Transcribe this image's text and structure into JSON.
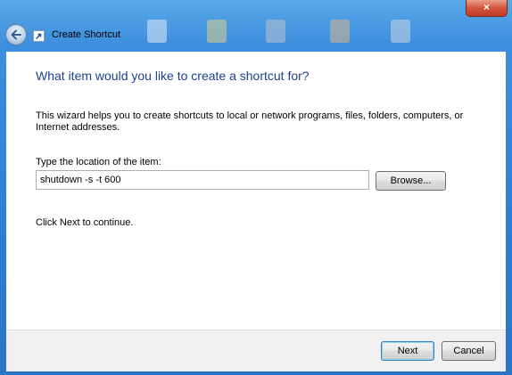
{
  "window": {
    "title": "Create Shortcut",
    "close_symbol": "×",
    "back_icon": "back-arrow-icon",
    "app_icon": "shortcut-icon"
  },
  "wizard": {
    "heading": "What item would you like to create a shortcut for?",
    "description": "This wizard helps you to create shortcuts to local or network programs, files, folders, computers, or Internet addresses.",
    "location_label": "Type the location of the item:",
    "location_value": "shutdown -s -t 600",
    "browse_label": "Browse...",
    "hint": "Click Next to continue."
  },
  "footer": {
    "next_label": "Next",
    "cancel_label": "Cancel"
  },
  "colors": {
    "frame": "#2d7fd4",
    "heading": "#1e3f8f",
    "close": "#c23b22"
  }
}
